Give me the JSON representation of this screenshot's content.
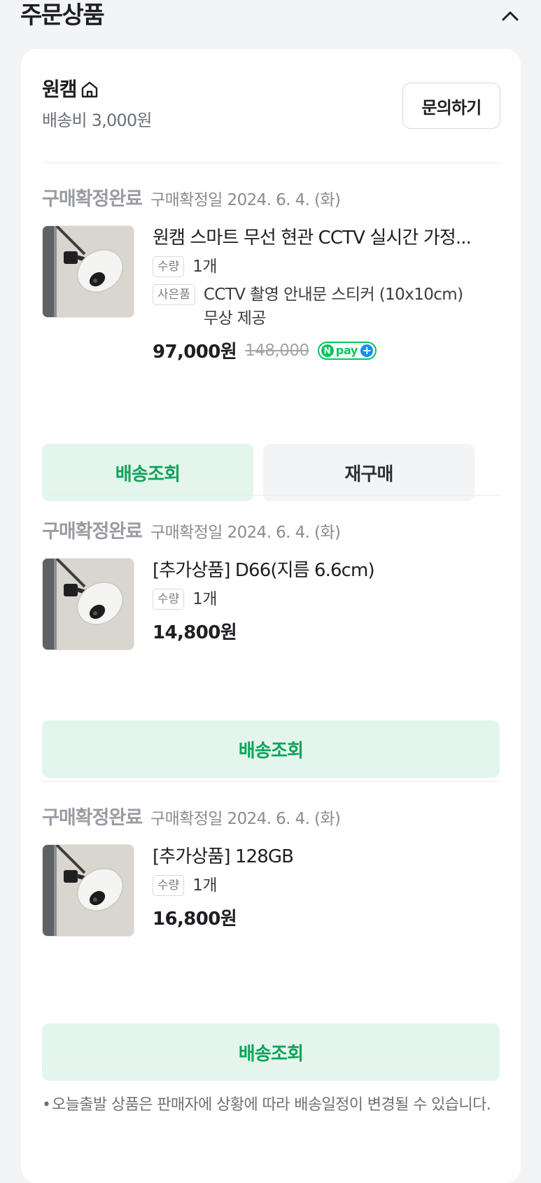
{
  "section": {
    "title": "주문상품"
  },
  "seller": {
    "name": "원캠",
    "shipping_fee": "배송비 3,000원",
    "inquiry_label": "문의하기"
  },
  "items": [
    {
      "status": "구매확정완료",
      "confirm_date": "구매확정일 2024. 6. 4. (화)",
      "name": "원캠 스마트 무선 현관 CCTV 실시간 가정...",
      "qty_tag": "수량",
      "qty": "1개",
      "gift_tag": "사은품",
      "gift": "CCTV 촬영 안내문 스티커 (10x10cm) 무상 제공",
      "price": "97,000원",
      "original_price": "148,000",
      "npay_label": "pay",
      "npay_icon": "naver-pay-plus-badge",
      "track_label": "배송조회",
      "rebuy_label": "재구매"
    },
    {
      "status": "구매확정완료",
      "confirm_date": "구매확정일 2024. 6. 4. (화)",
      "name": "[추가상품] D66(지름 6.6cm)",
      "qty_tag": "수량",
      "qty": "1개",
      "price": "14,800원",
      "track_label": "배송조회"
    },
    {
      "status": "구매확정완료",
      "confirm_date": "구매확정일 2024. 6. 4. (화)",
      "name": "[추가상품] 128GB",
      "qty_tag": "수량",
      "qty": "1개",
      "price": "16,800원",
      "track_label": "배송조회"
    }
  ],
  "notice": "오늘출발 상품은 판매자에 상황에 따라 배송일정이 변경될 수 있습니다.",
  "colors": {
    "accent_green": "#10a25a",
    "green_button_bg": "#e3f5ec",
    "npay_green": "#03c75a",
    "npay_blue": "#1a8cff"
  }
}
